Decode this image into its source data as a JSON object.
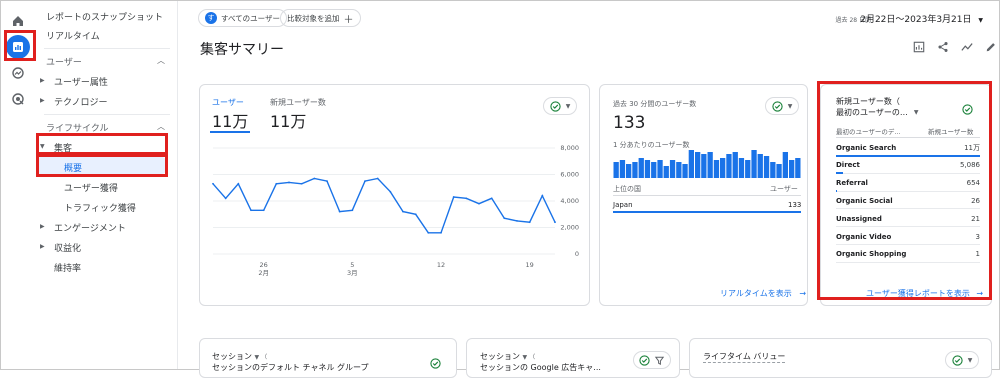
{
  "nav": {
    "snapshot": "レポートのスナップショット",
    "realtime": "リアルタイム",
    "user_section": "ユーザー",
    "user_attributes": "ユーザー属性",
    "technology": "テクノロジー",
    "lifecycle_section": "ライフサイクル",
    "acquisition": "集客",
    "overview": "概要",
    "user_acquisition": "ユーザー獲得",
    "traffic_acquisition": "トラフィック獲得",
    "engagement": "エンゲージメント",
    "monetization": "収益化",
    "retention": "維持率"
  },
  "topbar": {
    "all_users_badge": "す",
    "all_users": "すべてのユーザー",
    "add_comparison": "比較対象を追加",
    "date_small": "過去 28 日間",
    "date_range": "2月22日～2023年3月21日"
  },
  "page": {
    "title": "集客サマリー"
  },
  "card1": {
    "tab1_label": "ユーザー",
    "tab1_value": "11万",
    "tab2_label": "新規ユーザー数",
    "tab2_value": "11万",
    "y_ticks": [
      "8,000",
      "6,000",
      "4,000",
      "2,000",
      "0"
    ],
    "x_ticks": [
      "26",
      "5",
      "12",
      "19"
    ],
    "x_months": [
      "2月",
      "3月"
    ]
  },
  "chart_data": {
    "type": "line",
    "x": [
      "2/22",
      "2/23",
      "2/24",
      "2/25",
      "2/26",
      "2/27",
      "2/28",
      "3/1",
      "3/2",
      "3/3",
      "3/4",
      "3/5",
      "3/6",
      "3/7",
      "3/8",
      "3/9",
      "3/10",
      "3/11",
      "3/12",
      "3/13",
      "3/14",
      "3/15",
      "3/16",
      "3/17",
      "3/18",
      "3/19",
      "3/20",
      "3/21"
    ],
    "series": [
      {
        "values": [
          5300,
          4200,
          5300,
          3300,
          3300,
          5300,
          5400,
          5300,
          5700,
          5500,
          3200,
          3300,
          5500,
          5700,
          4700,
          3200,
          3000,
          1600,
          1600,
          4300,
          4200,
          3800,
          4200,
          2700,
          2500,
          2400,
          4400,
          2400
        ]
      }
    ],
    "ylim": [
      0,
      8000
    ],
    "grid": true
  },
  "card2": {
    "title": "過去 30 分間のユーザー数",
    "value": "133",
    "per_minute": "1 分あたりのユーザー数",
    "bars": [
      8,
      9,
      7,
      8,
      10,
      9,
      8,
      9,
      6,
      9,
      8,
      7,
      14,
      13,
      12,
      13,
      9,
      10,
      12,
      13,
      10,
      9,
      14,
      12,
      11,
      8,
      7,
      13,
      9,
      10
    ],
    "col_country": "上位の国",
    "col_users": "ユーザー",
    "country": "Japan",
    "country_value": "133",
    "link": "リアルタイムを表示"
  },
  "card3": {
    "title_line1": "新規ユーザー数（",
    "title_line2": "最初のユーザーの…",
    "col1": "最初のユーザーのデ...",
    "col2": "新規ユーザー数",
    "rows": [
      {
        "name": "Organic Search",
        "value": "11万",
        "share": 1.0
      },
      {
        "name": "Direct",
        "value": "5,086",
        "share": 0.05
      },
      {
        "name": "Referral",
        "value": "654",
        "share": 0.01
      },
      {
        "name": "Organic Social",
        "value": "26",
        "share": 0.0
      },
      {
        "name": "Unassigned",
        "value": "21",
        "share": 0.0
      },
      {
        "name": "Organic Video",
        "value": "3",
        "share": 0.0
      },
      {
        "name": "Organic Shopping",
        "value": "1",
        "share": 0.0
      }
    ],
    "link": "ユーザー獲得レポートを表示"
  },
  "bottom": {
    "c1_title": "セッション",
    "c1_sub": "セッションのデフォルト チャネル グループ",
    "c2_title": "セッション",
    "c2_sub": "セッションの Google 広告キャ...",
    "c3_title": "ライフタイム バリュー"
  },
  "colors": {
    "accent": "#1a73e8",
    "highlight": "#e0201e",
    "green": "#188038"
  }
}
